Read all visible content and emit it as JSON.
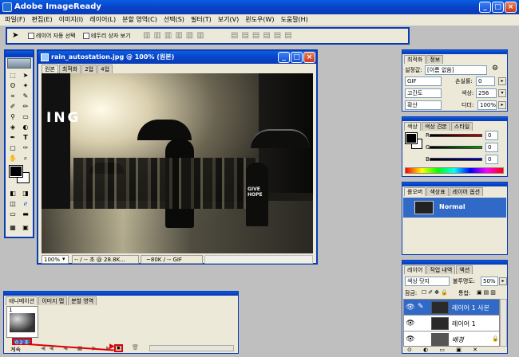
{
  "app": {
    "title": "Adobe ImageReady"
  },
  "menu": [
    "파일(F)",
    "편집(E)",
    "이미지(I)",
    "레이어(L)",
    "분할 영역(C)",
    "선택(S)",
    "필터(T)",
    "보기(V)",
    "윈도우(W)",
    "도움말(H)"
  ],
  "options_bar": {
    "auto_select_label": "레이어 자동 선택",
    "bounding_box_label": "테두리 상자 보기"
  },
  "document": {
    "title": "rain_autostation.jpg @ 100% (원본)",
    "tabs": [
      "원본",
      "최적화",
      "2업",
      "4업"
    ],
    "status": {
      "zoom": "100%",
      "time": "-- / -- 초 @ 28.8K...",
      "size": "~80K / -- GIF"
    },
    "image_text": [
      "GIVE",
      "HOPE"
    ],
    "image_letters": "ING"
  },
  "optimize": {
    "tabs": [
      "최적화",
      "정보"
    ],
    "preset_label": "설정값:",
    "preset_value": "[이름 없음]",
    "format": "GIF",
    "lossy_label": "손실률:",
    "lossy_value": "0",
    "palette": "고간도",
    "colors_label": "색상:",
    "colors_value": "256",
    "dither_method": "확산",
    "dither_label": "디더:",
    "dither_value": "100%"
  },
  "color": {
    "tabs": [
      "색상",
      "색상 견본",
      "스타일"
    ],
    "channels": [
      {
        "name": "R",
        "value": "0",
        "color": "#c00000"
      },
      {
        "name": "G",
        "value": "0",
        "color": "#00a000"
      },
      {
        "name": "B",
        "value": "0",
        "color": "#0000c0"
      }
    ]
  },
  "rollover": {
    "tabs": [
      "롤오버",
      "색상표",
      "레이어 옵션"
    ],
    "state": "Normal"
  },
  "layers": {
    "tabs": [
      "레이어",
      "작업 내역",
      "액션"
    ],
    "blend_mode": "색상 닷지",
    "opacity_label": "불투명도:",
    "opacity_value": "50%",
    "lock_label": "잠금:",
    "unify_label": "통합:",
    "items": [
      "레이어 1 사본",
      "레이어 1",
      "배경"
    ]
  },
  "animation": {
    "tabs": [
      "애니메이션",
      "이미지 맵",
      "분할 영역"
    ],
    "frame_number": "1",
    "frame_delay": "0.2 초",
    "loop": "계속"
  },
  "colors": {
    "accent": "#0a3cb4",
    "selection": "#3169c6",
    "highlight": "#e00000"
  }
}
